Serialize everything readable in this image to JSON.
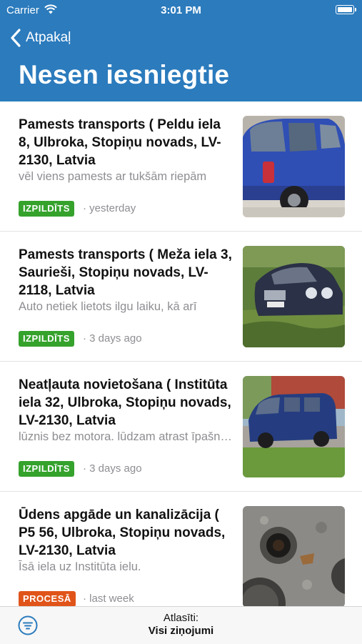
{
  "status_bar": {
    "carrier": "Carrier",
    "time": "3:01 PM"
  },
  "nav": {
    "back_label": "Atpakaļ",
    "title": "Nesen iesniegtie"
  },
  "items": [
    {
      "title": "Pamests transports ( Peldu iela 8, Ulbroka, Stopiņu novads, LV-2130, Latvia",
      "description": "vēl viens pamests ar tukšām riepām",
      "status": "IZPILDĪTS",
      "status_color": "#35a22c",
      "time": "· yesterday",
      "image_icon": "blue-hatchback-photo"
    },
    {
      "title": "Pamests transports ( Meža iela 3, Saurieši, Stopiņu novads, LV-2118, Latvia",
      "description": "Auto netiek lietots ilgu laiku, kā arī",
      "status": "IZPILDĪTS",
      "status_color": "#35a22c",
      "time": "· 3 days ago",
      "image_icon": "dark-sedan-photo"
    },
    {
      "title": "Neatļauta novietošana ( Institūta iela 32, Ulbroka, Stopiņu novads, LV-2130, Latvia",
      "description": "lūznis bez motora. lūdzam atrast īpašnieku",
      "status": "IZPILDĪTS",
      "status_color": "#35a22c",
      "time": "· 3 days ago",
      "image_icon": "blue-van-photo"
    },
    {
      "title": "Ūdens apgāde un kanalizācija ( P5 56, Ulbroka, Stopiņu novads, LV-2130, Latvia",
      "description": "Īsā iela uz Institūta ielu.",
      "status": "PROCESĀ",
      "status_color": "#e0541a",
      "time": "· last week",
      "image_icon": "manhole-photo"
    }
  ],
  "toolbar": {
    "selected_label": "Atlasīti:",
    "selected_value": "Visi ziņojumi"
  },
  "colors": {
    "header": "#2b7bbd",
    "done": "#35a22c",
    "in_progress": "#e0541a"
  }
}
